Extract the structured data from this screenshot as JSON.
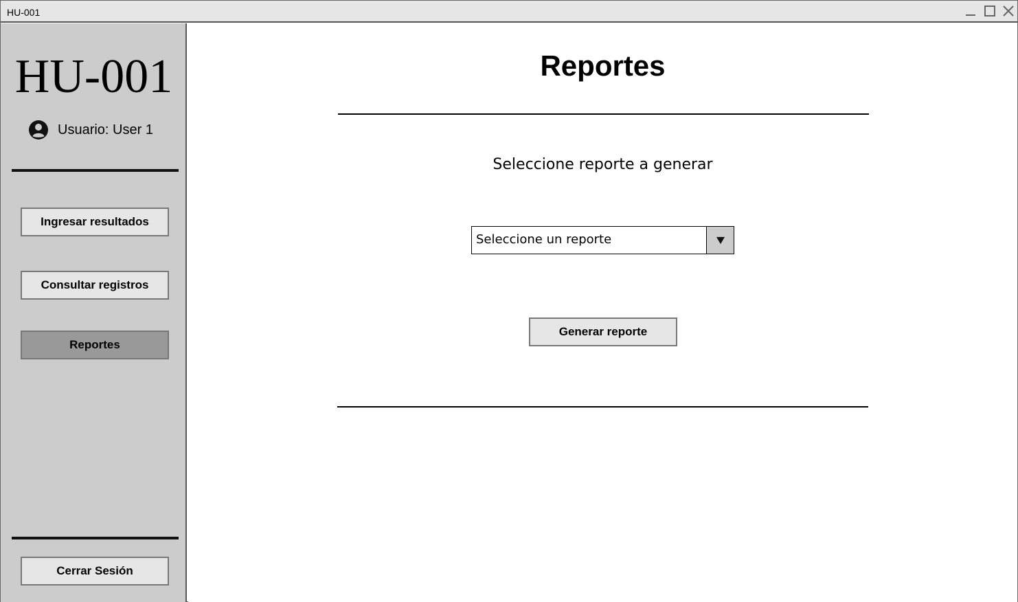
{
  "window": {
    "title": "HU-001"
  },
  "sidebar": {
    "brand": "HU-001",
    "user_label": "Usuario: User 1",
    "nav": [
      {
        "label": "Ingresar resultados",
        "active": false
      },
      {
        "label": "Consultar registros",
        "active": false
      },
      {
        "label": "Reportes",
        "active": true
      }
    ],
    "logout_label": "Cerrar Sesión"
  },
  "main": {
    "title": "Reportes",
    "prompt": "Seleccione reporte a generar",
    "report_select": {
      "value": "Seleccione un reporte"
    },
    "generate_label": "Generar reporte"
  },
  "colors": {
    "sidebar_bg": "#cccccc",
    "button_bg": "#e6e6e6",
    "active_button_bg": "#999999",
    "titlebar_bg": "#e6e6e6"
  },
  "icons": {
    "minimize": "minimize-icon",
    "maximize": "maximize-icon",
    "close": "close-icon",
    "user": "user-circle-icon",
    "dropdown": "triangle-down-icon"
  }
}
